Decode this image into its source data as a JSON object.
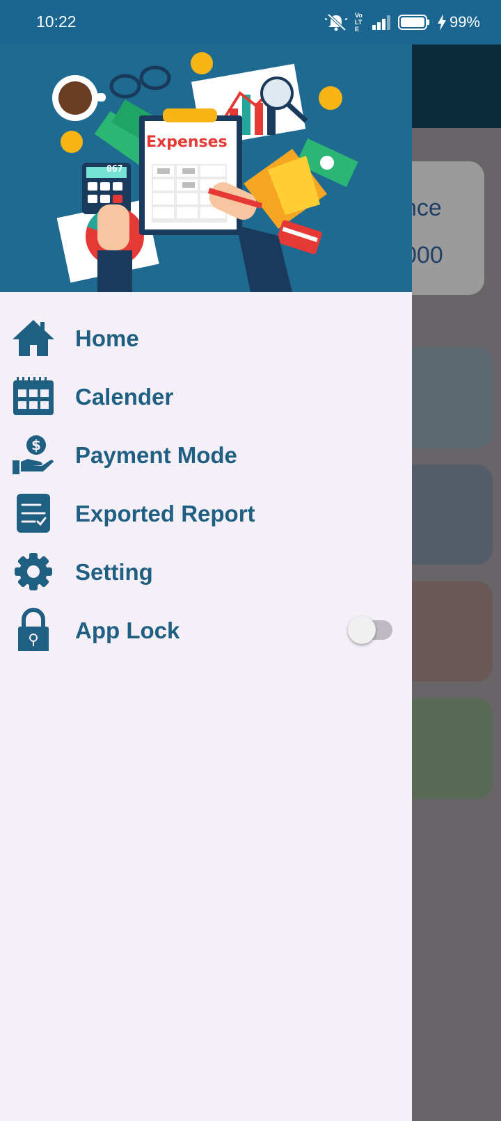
{
  "status_bar": {
    "time": "10:22",
    "volte": "Vo LTE",
    "battery": "99%"
  },
  "background": {
    "balance_label": "nce",
    "balance_value": "000"
  },
  "header": {
    "banner_text": "Expenses",
    "calculator_display": "067"
  },
  "menu": {
    "items": [
      {
        "label": "Home",
        "icon": "home-icon"
      },
      {
        "label": "Calender",
        "icon": "calendar-icon"
      },
      {
        "label": "Payment Mode",
        "icon": "payment-hand-icon"
      },
      {
        "label": "Exported Report",
        "icon": "report-icon"
      },
      {
        "label": "Setting",
        "icon": "gear-icon"
      },
      {
        "label": "App Lock",
        "icon": "lock-icon",
        "toggle": false
      }
    ]
  },
  "colors": {
    "primary": "#1e5f82",
    "header_bg": "#1f6a91",
    "drawer_bg": "#f5eff8"
  }
}
